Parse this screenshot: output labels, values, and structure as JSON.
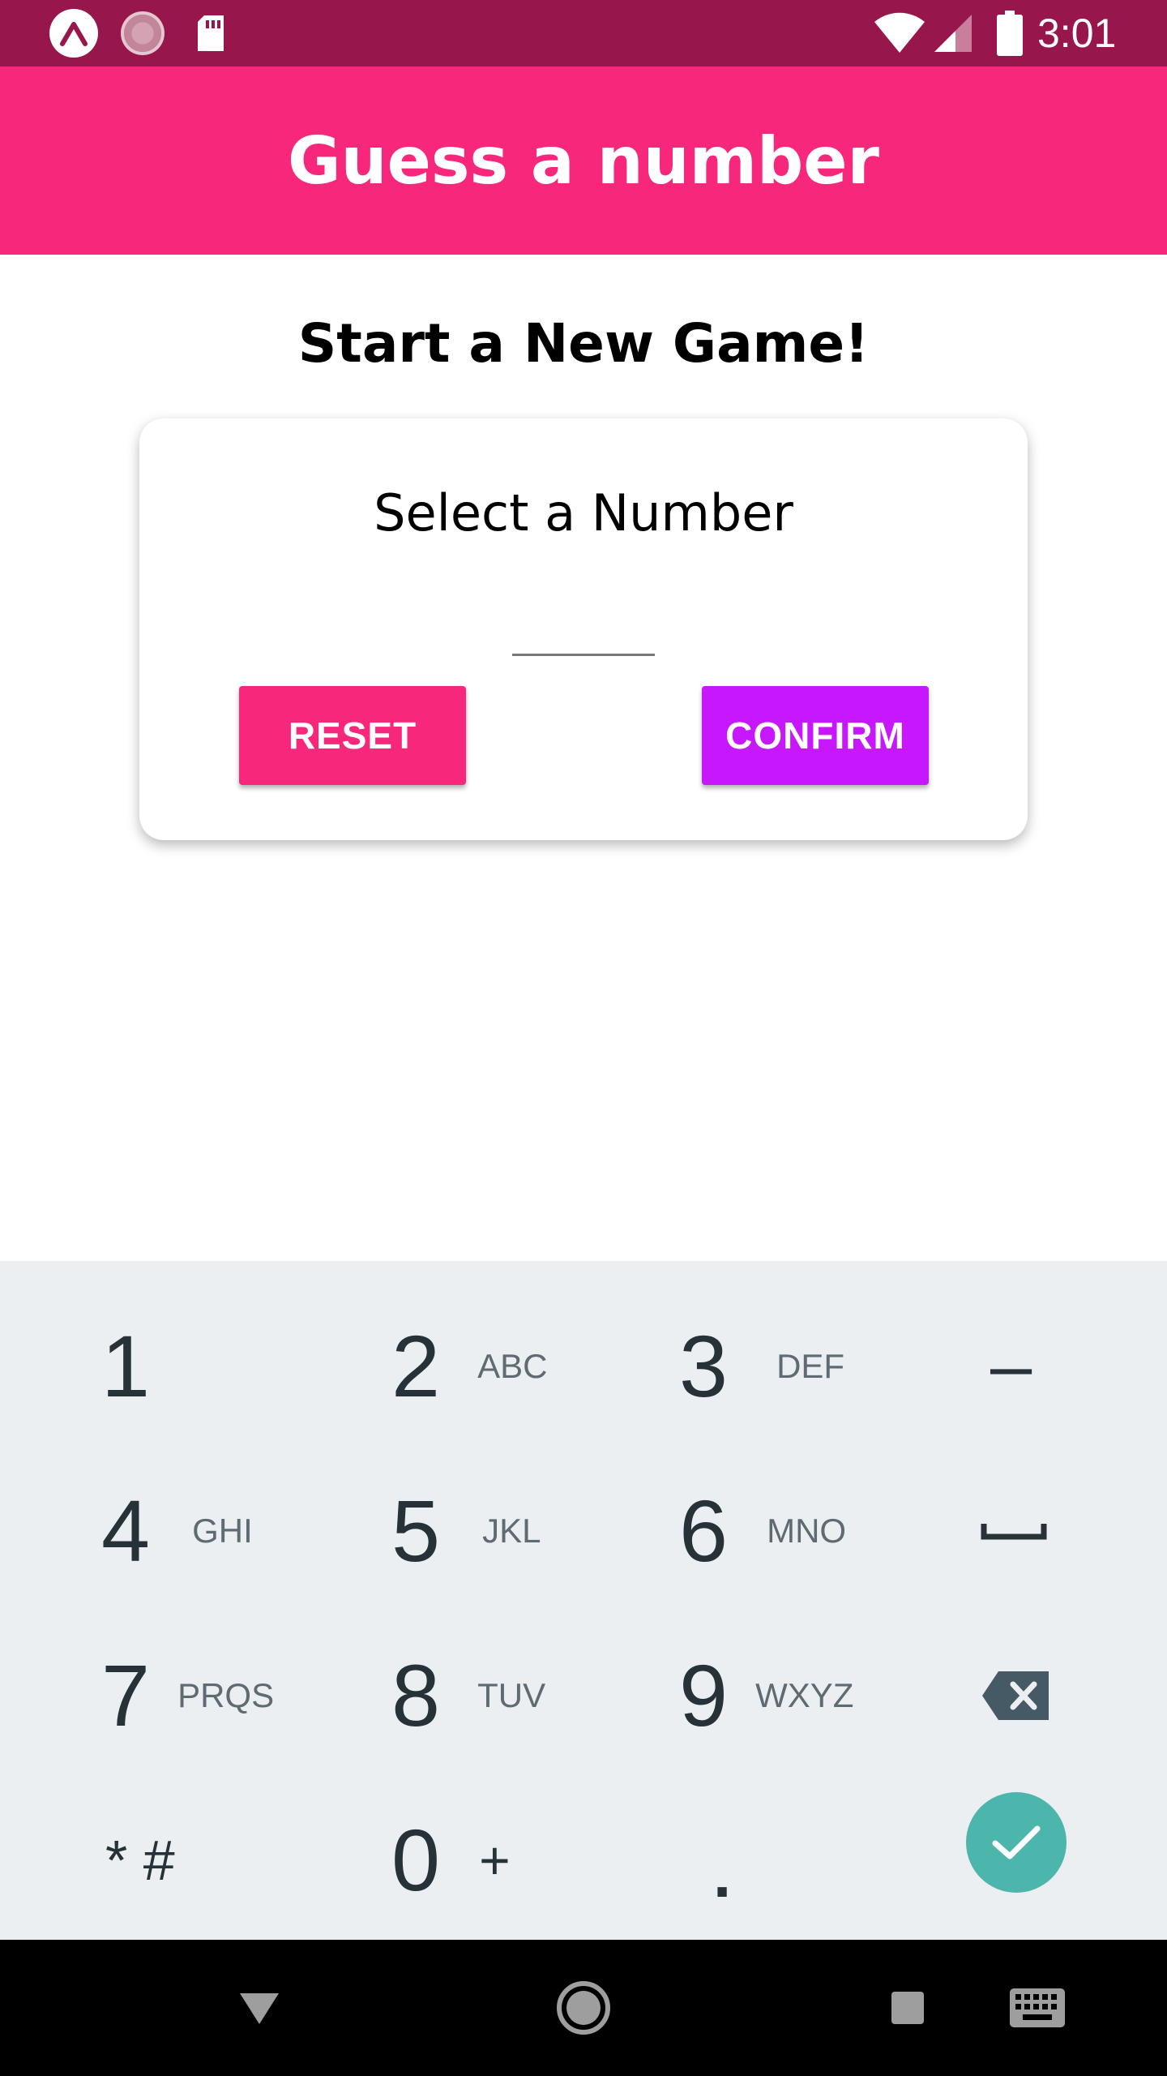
{
  "status_bar": {
    "time": "3:01",
    "icons": [
      "expo-app-icon",
      "loading-icon",
      "sd-card-icon",
      "wifi-icon",
      "signal-icon",
      "battery-icon"
    ]
  },
  "header": {
    "title": "Guess a number"
  },
  "main": {
    "screen_title": "Start a New Game!",
    "card": {
      "label": "Select a Number",
      "input_value": "",
      "reset_label": "RESET",
      "confirm_label": "CONFIRM"
    }
  },
  "keyboard": {
    "keys": [
      {
        "digit": "1",
        "letters": ""
      },
      {
        "digit": "2",
        "letters": "ABC"
      },
      {
        "digit": "3",
        "letters": "DEF"
      },
      {
        "digit": "4",
        "letters": "GHI"
      },
      {
        "digit": "5",
        "letters": "JKL"
      },
      {
        "digit": "6",
        "letters": "MNO"
      },
      {
        "digit": "7",
        "letters": "PRQS"
      },
      {
        "digit": "8",
        "letters": "TUV"
      },
      {
        "digit": "9",
        "letters": "WXYZ"
      },
      {
        "digit": "0",
        "letters": "+"
      }
    ],
    "symbols": {
      "minus": "–",
      "star_hash": "* #",
      "period": "."
    },
    "icons": [
      "space-icon",
      "backspace-icon",
      "done-check-icon"
    ]
  },
  "navigation_bar": {
    "icons": [
      "back-icon",
      "home-icon",
      "recents-icon",
      "keyboard-switch-icon"
    ]
  },
  "colors": {
    "status_bar": "#97174c",
    "header": "#f7287b",
    "reset_button": "#f7287b",
    "confirm_button": "#c717fc",
    "keyboard_background": "#eceff1",
    "done_key": "#4db6ac"
  }
}
